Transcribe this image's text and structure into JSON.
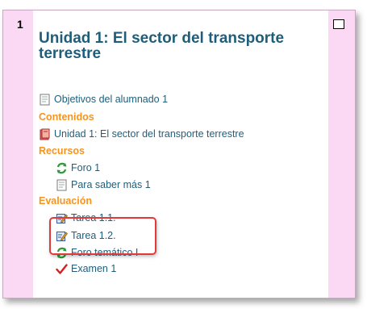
{
  "section": {
    "number": "1",
    "title": "Unidad 1: El sector del transporte terrestre"
  },
  "items": {
    "objetivos": {
      "label": "Objetivos del alumnado 1",
      "icon": "document-icon"
    },
    "contenidos_heading": "Contenidos",
    "unidad": {
      "label": "Unidad 1: El sector del transporte terrestre",
      "icon": "book-icon"
    },
    "recursos_heading": "Recursos",
    "foro1": {
      "label": "Foro 1",
      "icon": "forum-icon"
    },
    "saber": {
      "label": "Para saber más 1",
      "icon": "document-icon"
    },
    "evaluacion_heading": "Evaluación",
    "tarea11": {
      "label": "Tarea 1.1.",
      "icon": "assignment-icon"
    },
    "tarea12": {
      "label": "Tarea 1.2.",
      "icon": "assignment-icon"
    },
    "foro_tematico": {
      "label": "Foro temático I",
      "icon": "forum-icon"
    },
    "examen": {
      "label": "Examen 1",
      "icon": "quiz-check-icon"
    }
  },
  "colors": {
    "link": "#1f5e7a",
    "heading": "#f7941d",
    "section_bg": "#fbd9f4",
    "highlight": "#e23a3a"
  }
}
